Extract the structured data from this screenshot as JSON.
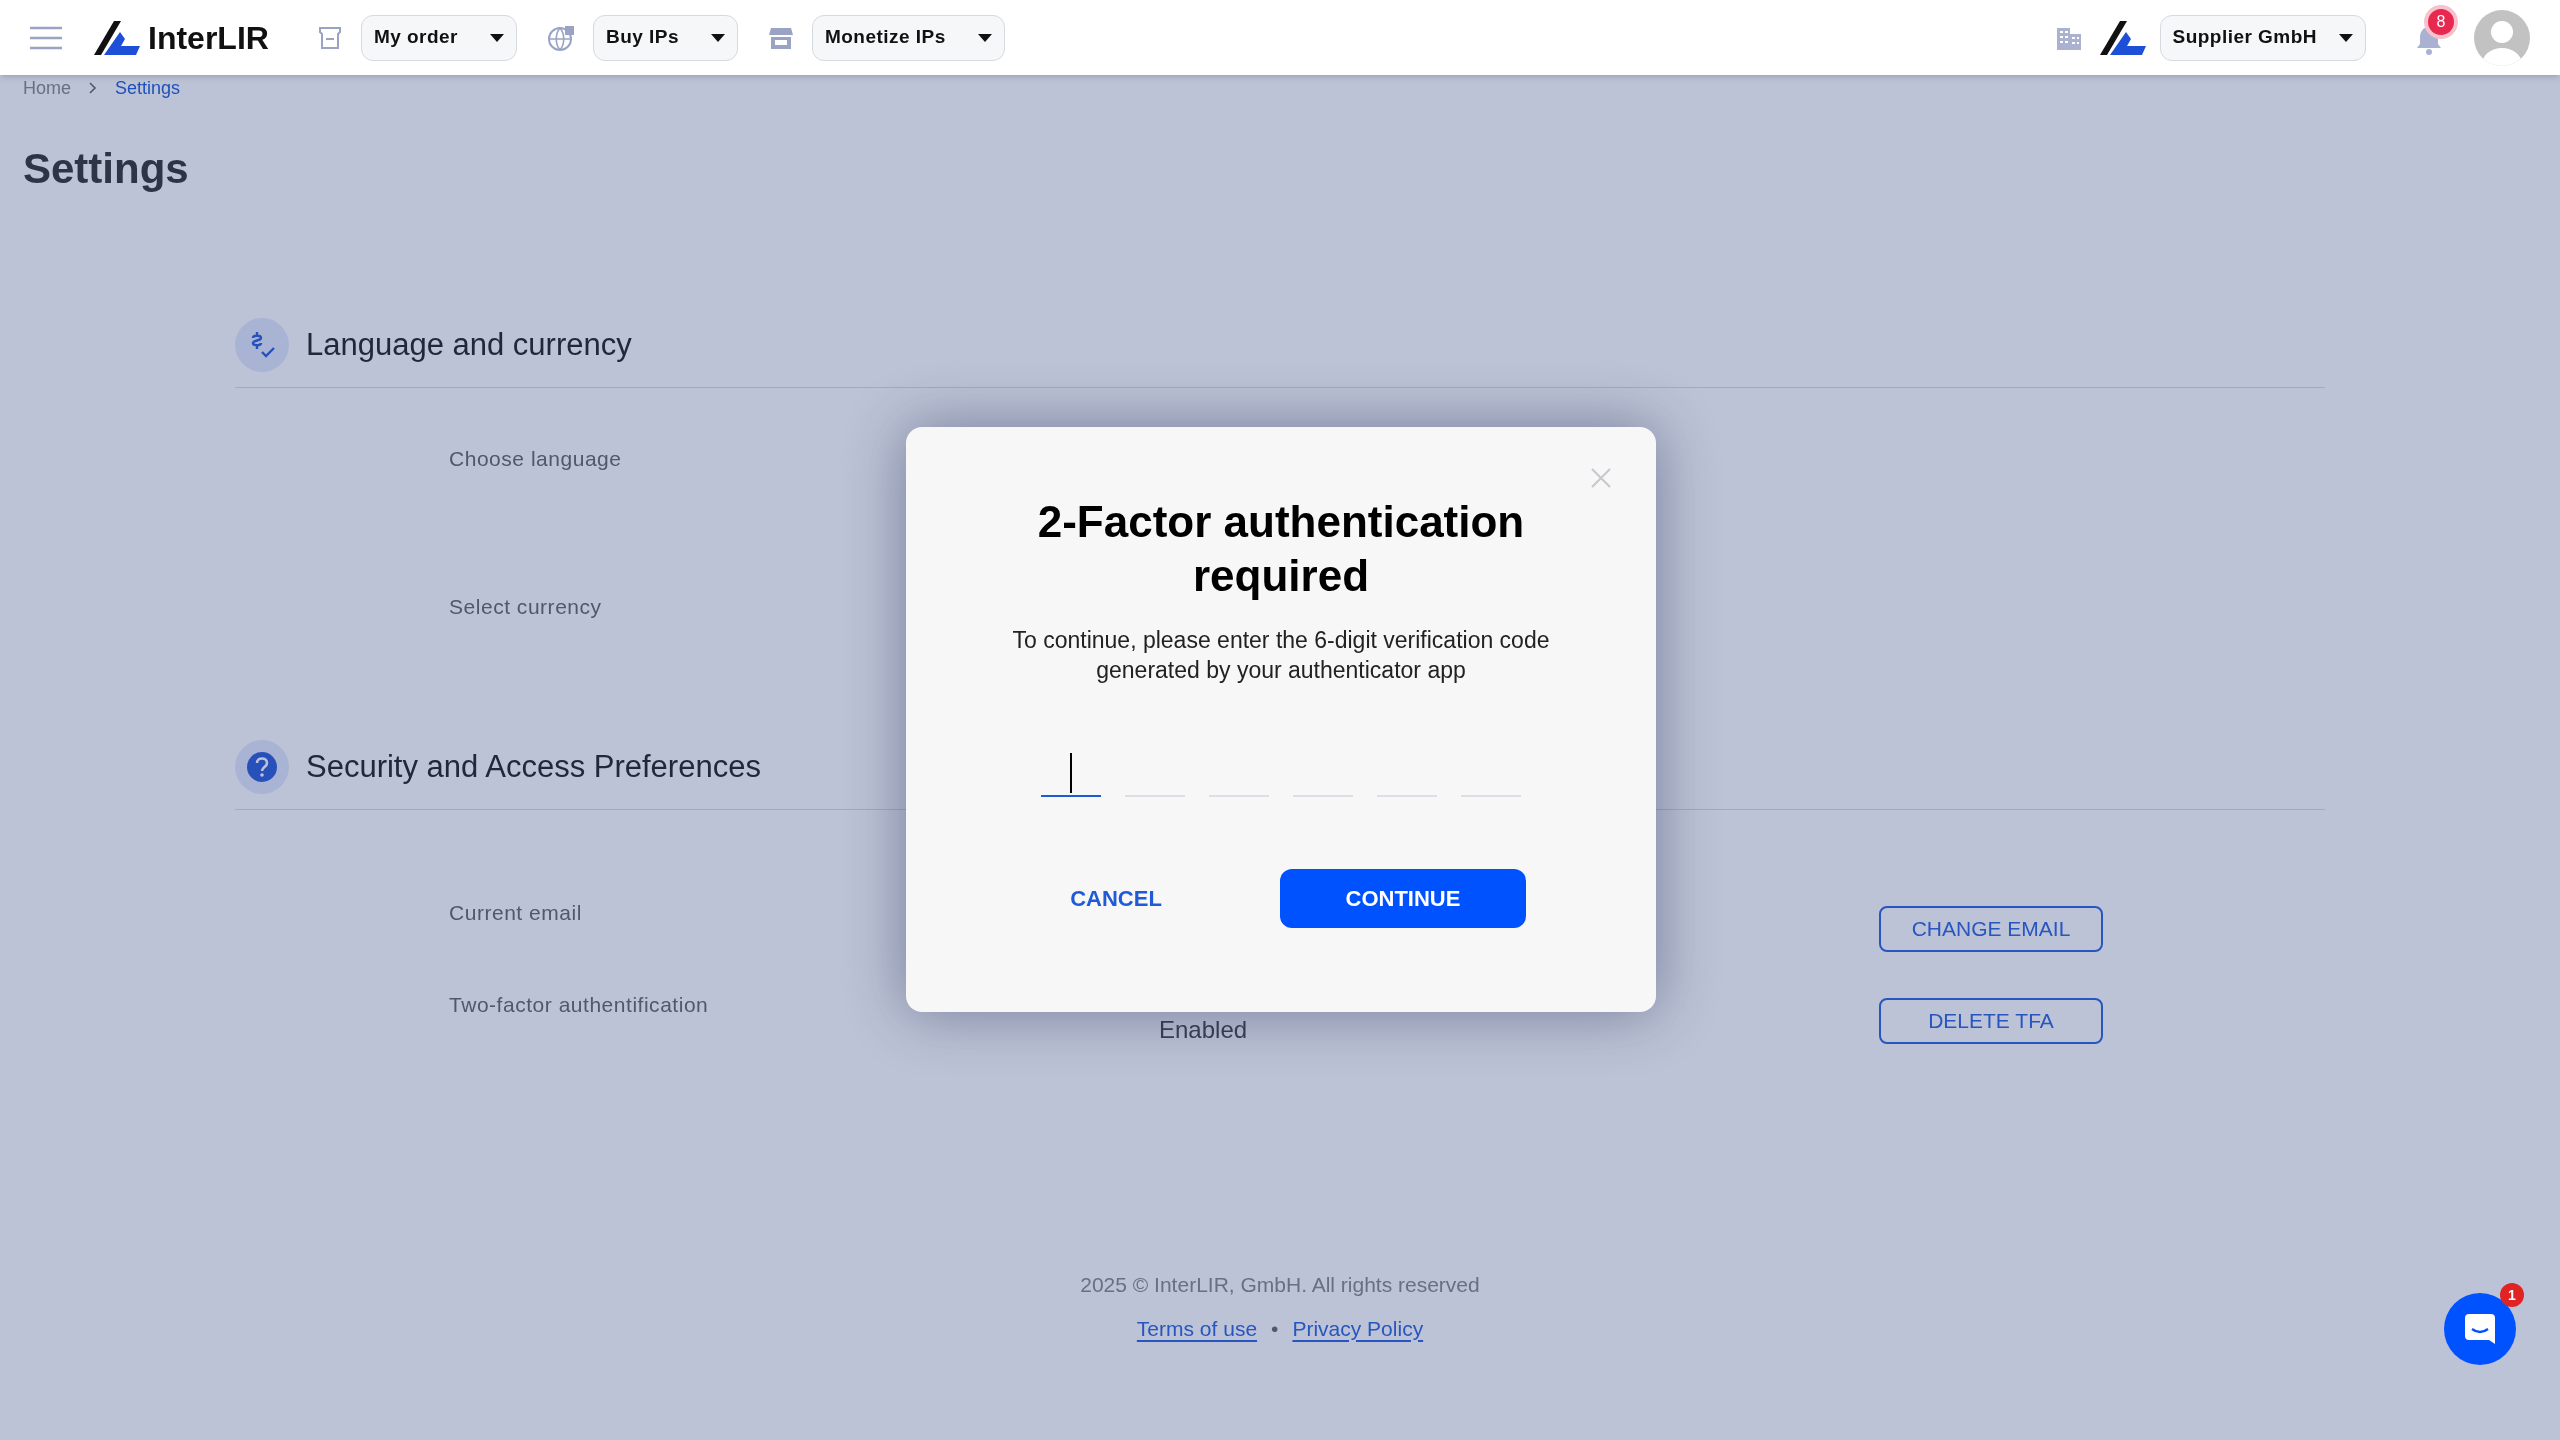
{
  "header": {
    "brand": "InterLIR",
    "nav": [
      {
        "kind": "box",
        "label": "My order"
      },
      {
        "kind": "globe",
        "label": "Buy IPs"
      },
      {
        "kind": "store",
        "label": "Monetize IPs"
      }
    ],
    "company": "Supplier GmbH",
    "notifications": "8"
  },
  "breadcrumb": [
    {
      "label": "Home",
      "selected": false
    },
    {
      "label": "Settings",
      "selected": true
    }
  ],
  "title": "Settings",
  "sections": [
    {
      "kind": "currency",
      "title": "Language and currency",
      "rows": [
        {
          "label": "Choose language"
        },
        {
          "label": "Select currency"
        }
      ]
    },
    {
      "kind": "help",
      "title": "Security and Access Preferences",
      "rows": [
        {
          "label": "Current email",
          "button": "CHANGE EMAIL"
        },
        {
          "label": "Two-factor authentification",
          "value": "Enabled",
          "button": "DELETE TFA"
        }
      ]
    }
  ],
  "footer": {
    "copyright": "2025 © InterLIR, GmbH. All rights reserved",
    "links": [
      "Terms of use",
      "Privacy Policy"
    ],
    "separator": "•"
  },
  "chat": {
    "badge": "1"
  },
  "modal": {
    "title": "2-Factor authentication required",
    "message": "To continue, please enter the 6-digit verification code generated by your authenticator app",
    "digits": [
      {
        "focused": true
      },
      {
        "focused": false
      },
      {
        "focused": false
      },
      {
        "focused": false
      },
      {
        "focused": false
      },
      {
        "focused": false
      }
    ],
    "cancel": "CANCEL",
    "confirm": "CONTINUE"
  }
}
